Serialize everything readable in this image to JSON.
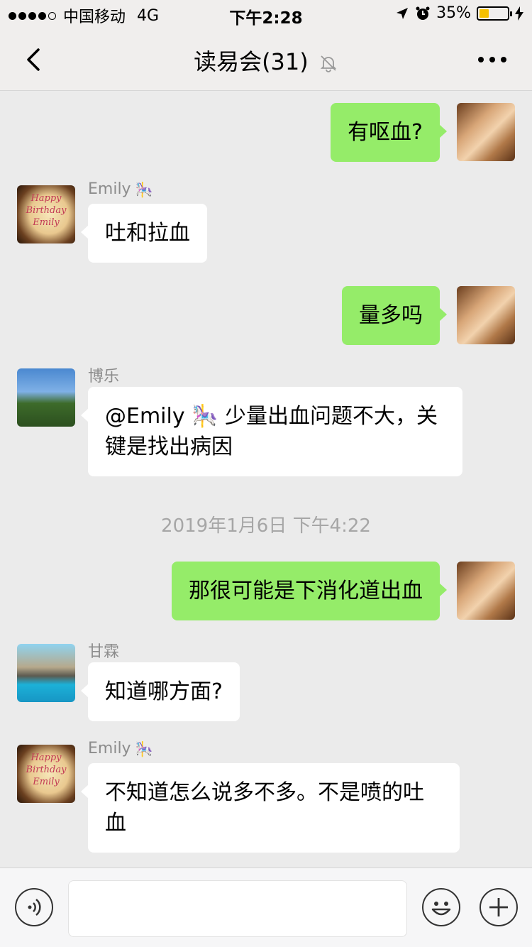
{
  "status": {
    "carrier": "中国移动",
    "network": "4G",
    "time": "下午2:28",
    "battery_pct": "35%",
    "battery_level": 0.35,
    "battery_color": "#f5c000"
  },
  "nav": {
    "title": "读易会(31)",
    "back_icon": "chevron-left-icon",
    "mute_icon": "bell-slash-icon",
    "more_icon": "ellipsis-icon"
  },
  "messages": [
    {
      "from": "me",
      "text": "有呕血?"
    },
    {
      "from": "other",
      "sender": "Emily",
      "text": "吐和拉血"
    },
    {
      "from": "me",
      "text": "量多吗"
    },
    {
      "from": "other",
      "sender": "博乐",
      "text": "@Emily 🎠 少量出血问题不大，关键是找出病因"
    },
    {
      "timestamp": "2019年1月6日 下午4:22"
    },
    {
      "from": "me",
      "text": "那很可能是下消化道出血"
    },
    {
      "from": "other",
      "sender": "甘霖",
      "text": "知道哪方面?"
    },
    {
      "from": "other",
      "sender": "Emily",
      "text": "不知道怎么说多不多。不是喷的吐血"
    }
  ],
  "avatars": {
    "emily_cake_text": "Happy Birthday Emily"
  },
  "colors": {
    "outgoing_bubble": "#95ec69",
    "incoming_bubble": "#ffffff",
    "background": "#ebebeb"
  },
  "input": {
    "voice_icon": "voice-icon",
    "emoji_icon": "smiley-icon",
    "plus_icon": "plus-icon"
  }
}
